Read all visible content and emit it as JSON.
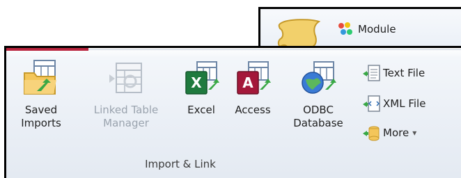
{
  "back_ribbon": {
    "module_label": "Module"
  },
  "import_link": {
    "group_label": "Import & Link",
    "saved_imports": {
      "line1": "Saved",
      "line2": "Imports"
    },
    "linked_table_manager": {
      "line1": "Linked Table",
      "line2": "Manager"
    },
    "excel": {
      "line1": "Excel"
    },
    "access": {
      "line1": "Access"
    },
    "odbc": {
      "line1": "ODBC",
      "line2": "Database"
    },
    "text_file": "Text File",
    "xml_file": "XML File",
    "more": "More",
    "more_arrow": "▾"
  },
  "icons": {
    "module": "module-icon",
    "scroll": "scroll-icon",
    "saved_imports": "folder-table-import-icon",
    "linked_table_manager": "linked-table-manager-icon",
    "excel": "excel-icon",
    "access": "access-icon",
    "odbc": "odbc-database-icon",
    "text_file": "text-file-icon",
    "xml_file": "xml-file-icon",
    "more": "more-icon"
  }
}
